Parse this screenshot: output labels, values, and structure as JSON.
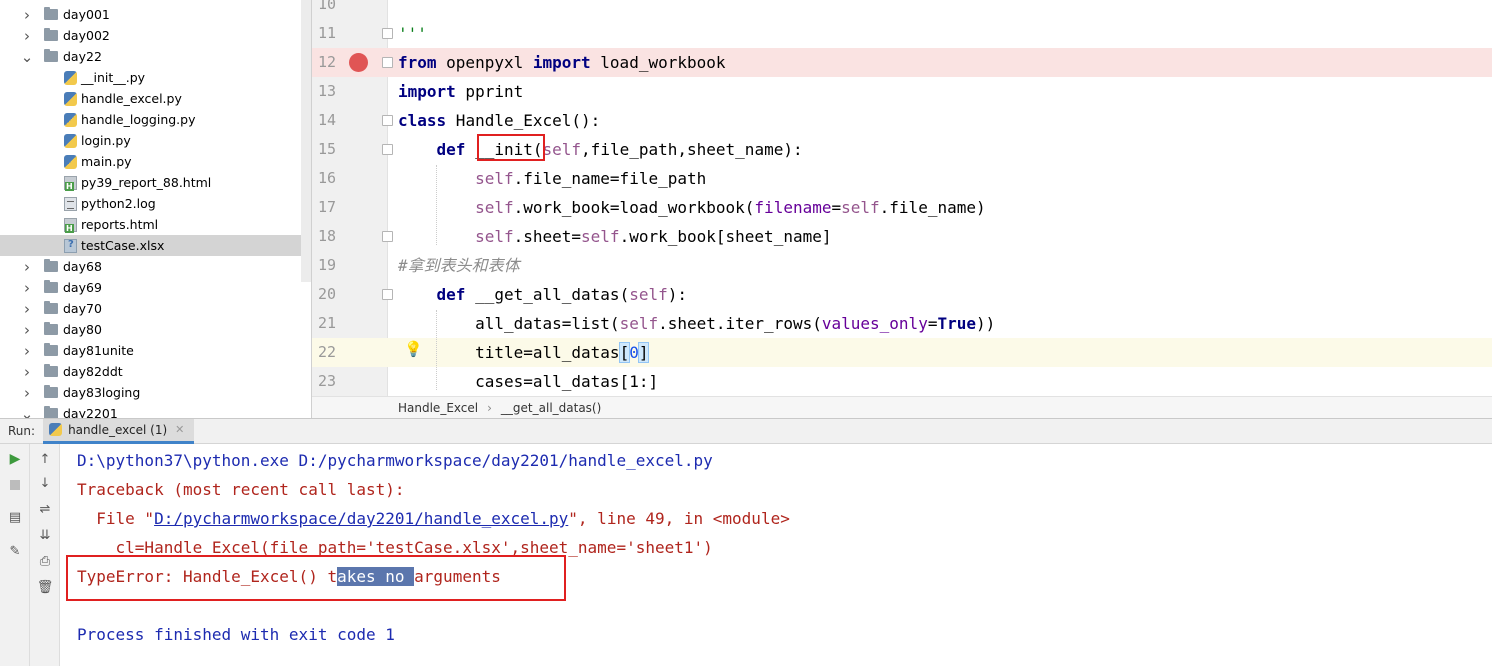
{
  "tree": {
    "items": [
      {
        "label": "day001",
        "type": "folder",
        "expanded": false,
        "depth": 0
      },
      {
        "label": "day002",
        "type": "folder",
        "expanded": false,
        "depth": 0
      },
      {
        "label": "day22",
        "type": "folder",
        "expanded": true,
        "depth": 0
      },
      {
        "label": "__init__.py",
        "type": "py",
        "depth": 1
      },
      {
        "label": "handle_excel.py",
        "type": "py",
        "depth": 1
      },
      {
        "label": "handle_logging.py",
        "type": "py",
        "depth": 1
      },
      {
        "label": "login.py",
        "type": "py",
        "depth": 1
      },
      {
        "label": "main.py",
        "type": "py",
        "depth": 1
      },
      {
        "label": "py39_report_88.html",
        "type": "html",
        "depth": 1
      },
      {
        "label": "python2.log",
        "type": "log",
        "depth": 1
      },
      {
        "label": "reports.html",
        "type": "html",
        "depth": 1
      },
      {
        "label": "testCase.xlsx",
        "type": "xlsx",
        "depth": 1,
        "selected": true
      },
      {
        "label": "day68",
        "type": "folder",
        "expanded": false,
        "depth": 0
      },
      {
        "label": "day69",
        "type": "folder",
        "expanded": false,
        "depth": 0
      },
      {
        "label": "day70",
        "type": "folder",
        "expanded": false,
        "depth": 0
      },
      {
        "label": "day80",
        "type": "folder",
        "expanded": false,
        "depth": 0
      },
      {
        "label": "day81unite",
        "type": "folder",
        "expanded": false,
        "depth": 0
      },
      {
        "label": "day82ddt",
        "type": "folder",
        "expanded": false,
        "depth": 0
      },
      {
        "label": "day83loging",
        "type": "folder",
        "expanded": false,
        "depth": 0
      },
      {
        "label": "day2201",
        "type": "folder",
        "expanded": true,
        "depth": 0
      }
    ]
  },
  "editor": {
    "lines": [
      {
        "num": "10",
        "tokens": []
      },
      {
        "num": "11",
        "tokens": [
          {
            "t": "'''",
            "c": "str"
          }
        ]
      },
      {
        "num": "12",
        "breakpoint": true,
        "tokens": [
          {
            "t": "from",
            "c": "kw"
          },
          {
            "t": " openpyxl ",
            "c": ""
          },
          {
            "t": "import",
            "c": "kw"
          },
          {
            "t": " load_workbook",
            "c": ""
          }
        ]
      },
      {
        "num": "13",
        "tokens": [
          {
            "t": "import",
            "c": "kw"
          },
          {
            "t": " pprint",
            "c": ""
          }
        ]
      },
      {
        "num": "14",
        "tokens": [
          {
            "t": "class",
            "c": "kw"
          },
          {
            "t": " Handle_Excel():",
            "c": ""
          }
        ]
      },
      {
        "num": "15",
        "tokens": [
          {
            "t": "    ",
            "c": ""
          },
          {
            "t": "def",
            "c": "kw"
          },
          {
            "t": " __init",
            "c": ""
          },
          {
            "t": "(",
            "c": ""
          },
          {
            "t": "self",
            "c": "self"
          },
          {
            "t": ",file_path,sheet_name):",
            "c": ""
          }
        ]
      },
      {
        "num": "16",
        "tokens": [
          {
            "t": "        ",
            "c": ""
          },
          {
            "t": "self",
            "c": "self"
          },
          {
            "t": ".file_name=file_path",
            "c": ""
          }
        ]
      },
      {
        "num": "17",
        "tokens": [
          {
            "t": "        ",
            "c": ""
          },
          {
            "t": "self",
            "c": "self"
          },
          {
            "t": ".work_book=load_workbook(",
            "c": ""
          },
          {
            "t": "filename",
            "c": "param"
          },
          {
            "t": "=",
            "c": ""
          },
          {
            "t": "self",
            "c": "self"
          },
          {
            "t": ".file_name)",
            "c": ""
          }
        ]
      },
      {
        "num": "18",
        "tokens": [
          {
            "t": "        ",
            "c": ""
          },
          {
            "t": "self",
            "c": "self"
          },
          {
            "t": ".sheet=",
            "c": ""
          },
          {
            "t": "self",
            "c": "self"
          },
          {
            "t": ".work_book[sheet_name]",
            "c": ""
          }
        ]
      },
      {
        "num": "19",
        "tokens": [
          {
            "t": "#拿到表头和表体",
            "c": "cmt"
          }
        ]
      },
      {
        "num": "20",
        "tokens": [
          {
            "t": "    ",
            "c": ""
          },
          {
            "t": "def",
            "c": "kw"
          },
          {
            "t": " __get_all_datas(",
            "c": ""
          },
          {
            "t": "self",
            "c": "self"
          },
          {
            "t": "):",
            "c": ""
          }
        ]
      },
      {
        "num": "21",
        "tokens": [
          {
            "t": "        all_datas=list(",
            "c": ""
          },
          {
            "t": "self",
            "c": "self"
          },
          {
            "t": ".sheet.iter_rows(",
            "c": ""
          },
          {
            "t": "values_only",
            "c": "param"
          },
          {
            "t": "=",
            "c": ""
          },
          {
            "t": "True",
            "c": "kw"
          },
          {
            "t": "))",
            "c": ""
          }
        ]
      },
      {
        "num": "22",
        "caret": true,
        "bulb": true,
        "tokens": [
          {
            "t": "        title=all_datas",
            "c": ""
          },
          {
            "t": "[",
            "c": "bhl"
          },
          {
            "t": "0",
            "c": "num"
          },
          {
            "t": "]",
            "c": "bhl"
          }
        ]
      },
      {
        "num": "23",
        "tokens": [
          {
            "t": "        cases=all_datas[1:]",
            "c": ""
          }
        ]
      }
    ],
    "breadcrumbs": [
      "Handle_Excel",
      "__get_all_datas()"
    ]
  },
  "run": {
    "label": "Run:",
    "tab_label": "handle_excel (1)",
    "console": [
      {
        "text": "D:\\python37\\python.exe D:/pycharmworkspace/day2201/handle_excel.py",
        "style": "blue"
      },
      {
        "text": "Traceback (most recent call last):",
        "style": "red"
      },
      {
        "prefix": "  File \"",
        "link": "D:/pycharmworkspace/day2201/handle_excel.py",
        "suffix": "\", line 49, in <module>",
        "style": "red"
      },
      {
        "text": "    cl=Handle_Excel(file_path='testCase.xlsx',sheet_name='sheet1')",
        "style": "red"
      },
      {
        "pre": "TypeError: Handle_Excel() t",
        "sel": "akes no ",
        "post": "arguments",
        "style": "red"
      },
      {
        "text": "",
        "style": "blue"
      },
      {
        "text": "Process finished with exit code 1",
        "style": "blue"
      }
    ]
  }
}
